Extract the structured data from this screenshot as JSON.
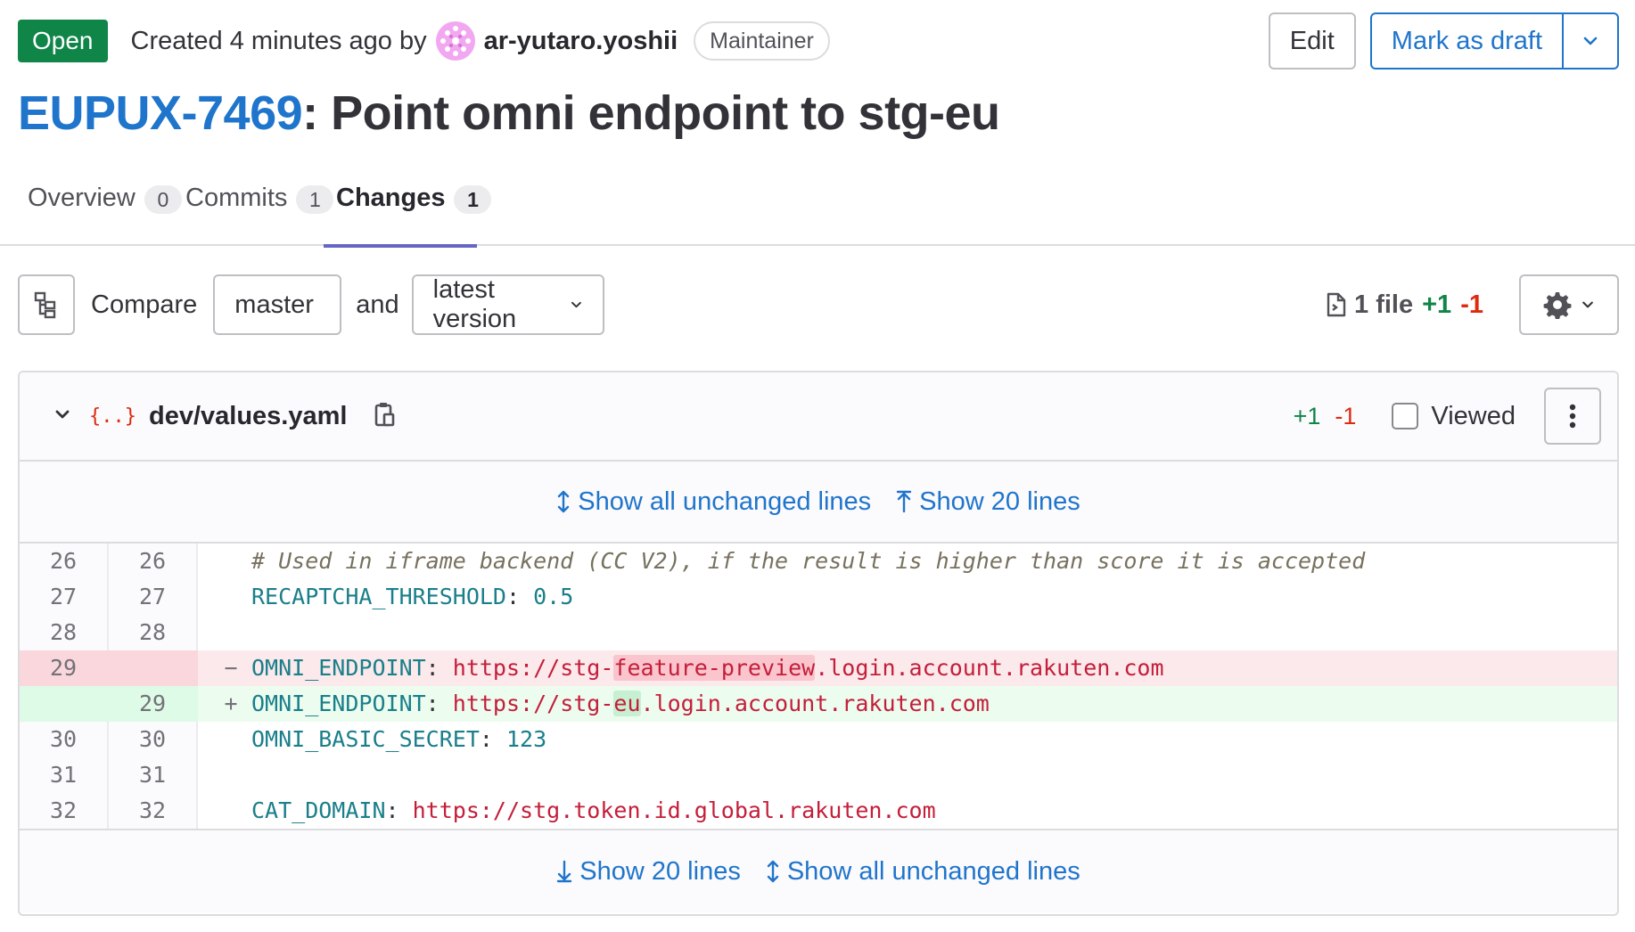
{
  "header": {
    "status": "Open",
    "created_text": "Created 4 minutes ago by",
    "author": "ar-yutaro.yoshii",
    "role": "Maintainer",
    "edit_label": "Edit",
    "draft_label": "Mark as draft"
  },
  "title": {
    "ref": "EUPUX-7469",
    "rest": ": Point omni endpoint to stg-eu"
  },
  "tabs": [
    {
      "label": "Overview",
      "count": "0"
    },
    {
      "label": "Commits",
      "count": "1"
    },
    {
      "label": "Changes",
      "count": "1"
    }
  ],
  "toolbar": {
    "compare_label": "Compare",
    "source": "master",
    "and_label": "and",
    "target": "latest version",
    "files": "1 file",
    "added": "+1",
    "removed": "-1"
  },
  "diff_file": {
    "name": "dev/values.yaml",
    "added": "+1",
    "removed": "-1",
    "viewed_label": "Viewed",
    "expand_all": "Show all unchanged lines",
    "expand_20": "Show 20 lines",
    "lines": [
      {
        "old": "26",
        "new": "26",
        "sign": "",
        "type": "context"
      },
      {
        "old": "27",
        "new": "27",
        "sign": "",
        "type": "context"
      },
      {
        "old": "28",
        "new": "28",
        "sign": "",
        "type": "context"
      },
      {
        "old": "29",
        "new": "",
        "sign": "−",
        "type": "old"
      },
      {
        "old": "",
        "new": "29",
        "sign": "+",
        "type": "new"
      },
      {
        "old": "30",
        "new": "30",
        "sign": "",
        "type": "context"
      },
      {
        "old": "31",
        "new": "31",
        "sign": "",
        "type": "context"
      },
      {
        "old": "32",
        "new": "32",
        "sign": "",
        "type": "context"
      }
    ],
    "code": {
      "l26": "# Used in iframe backend (CC V2), if the result is higher than score it is accepted",
      "l27_key": "RECAPTCHA_THRESHOLD",
      "l27_val": "0.5",
      "l29_key": "OMNI_ENDPOINT",
      "old_prefix": "https://stg-",
      "old_changed": "feature-preview",
      "suffix": ".login.account.rakuten.com",
      "new_prefix": "https://stg-",
      "new_changed": "eu",
      "l30_key": "OMNI_BASIC_SECRET",
      "l30_val": "123",
      "l32_key": "CAT_DOMAIN",
      "l32_val": "https://stg.token.id.global.rakuten.com"
    }
  },
  "colors": {
    "status_green": "#108548",
    "link_blue": "#1f75cb",
    "added_green": "#108548",
    "removed_red": "#dd2b0e",
    "active_tab": "#6666c4"
  }
}
